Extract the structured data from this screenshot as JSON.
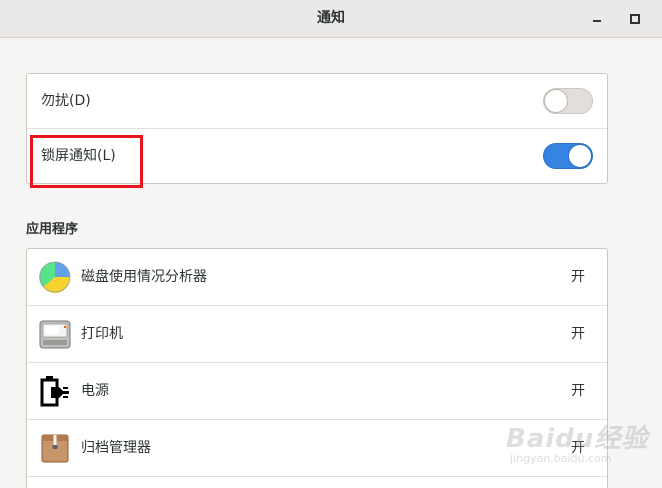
{
  "window": {
    "title": "通知",
    "minimize_icon": "minimize-icon",
    "maximize_icon": "maximize-icon"
  },
  "switches": [
    {
      "label": "勿扰(D)",
      "state": "off"
    },
    {
      "label": "锁屏通知(L)",
      "state": "on"
    }
  ],
  "apps_section": {
    "heading": "应用程序",
    "items": [
      {
        "name": "磁盘使用情况分析器",
        "status": "开",
        "icon": "disk-usage-icon"
      },
      {
        "name": "打印机",
        "status": "开",
        "icon": "printer-icon"
      },
      {
        "name": "电源",
        "status": "开",
        "icon": "power-icon"
      },
      {
        "name": "归档管理器",
        "status": "开",
        "icon": "archive-icon"
      }
    ]
  },
  "colors": {
    "accent": "#3584e4",
    "highlight": "#e8141b"
  },
  "watermark": {
    "main": "Baidu经验",
    "sub": "jingyan.baidu.com"
  }
}
